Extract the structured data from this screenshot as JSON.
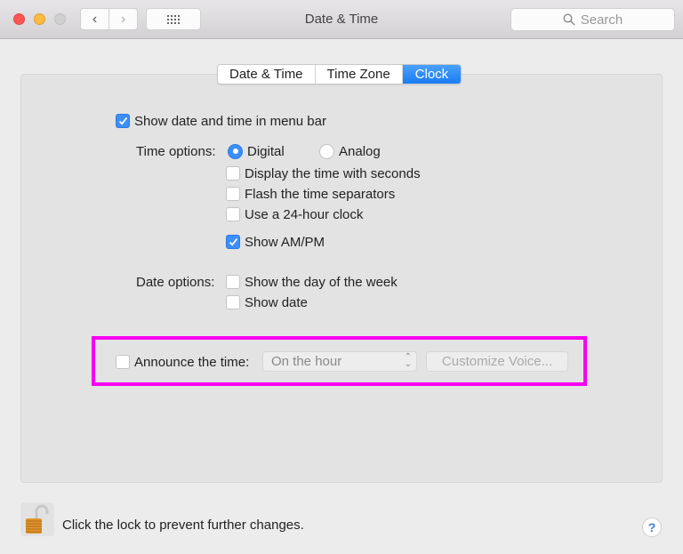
{
  "window": {
    "title": "Date & Time",
    "search_placeholder": "Search",
    "back_icon": "‹",
    "forward_icon": "›"
  },
  "tabs": [
    {
      "label": "Date & Time",
      "active": false
    },
    {
      "label": "Time Zone",
      "active": false
    },
    {
      "label": "Clock",
      "active": true
    }
  ],
  "clock": {
    "show_in_menu_bar": {
      "label": "Show date and time in menu bar",
      "checked": true
    },
    "time_options_label": "Time options:",
    "time_style": [
      {
        "label": "Digital",
        "selected": true
      },
      {
        "label": "Analog",
        "selected": false
      }
    ],
    "time_checkboxes": [
      {
        "label": "Display the time with seconds",
        "checked": false
      },
      {
        "label": "Flash the time separators",
        "checked": false
      },
      {
        "label": "Use a 24-hour clock",
        "checked": false
      },
      {
        "label": "Show AM/PM",
        "checked": true
      }
    ],
    "date_options_label": "Date options:",
    "date_checkboxes": [
      {
        "label": "Show the day of the week",
        "checked": false
      },
      {
        "label": "Show date",
        "checked": false
      }
    ],
    "announce": {
      "label": "Announce the time:",
      "checked": false,
      "interval_value": "On the hour",
      "customize_label": "Customize Voice..."
    }
  },
  "highlight_color": "#f700f0",
  "accent_color": "#1a7cf5",
  "footer": {
    "lock_text": "Click the lock to prevent further changes.",
    "help_label": "?"
  }
}
